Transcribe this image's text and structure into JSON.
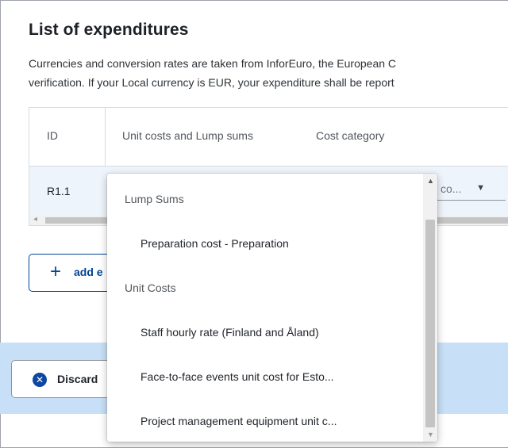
{
  "section": {
    "title": "List of expenditures",
    "description_line1": "Currencies and conversion rates are taken from InforEuro, the European C",
    "description_line2": "verification. If your Local currency is EUR, your expenditure shall be report"
  },
  "table": {
    "headers": [
      "ID",
      "Unit costs and Lump sums",
      "Cost category"
    ],
    "rows": [
      {
        "id": "R1.1",
        "cost_category_value": "co..."
      }
    ]
  },
  "buttons": {
    "add_label": "add e",
    "discard_label": "Discard"
  },
  "dropdown": {
    "groups": [
      {
        "label": "Lump Sums",
        "options": [
          "Preparation cost - Preparation"
        ]
      },
      {
        "label": "Unit Costs",
        "options": [
          "Staff hourly rate (Finland and Åland)",
          "Face-to-face events unit cost for Esto...",
          "Project management equipment unit c..."
        ]
      }
    ]
  },
  "colors": {
    "primary": "#004494",
    "footer_bg": "#c8e0f7",
    "selected_row_bg": "#eef4fb"
  }
}
